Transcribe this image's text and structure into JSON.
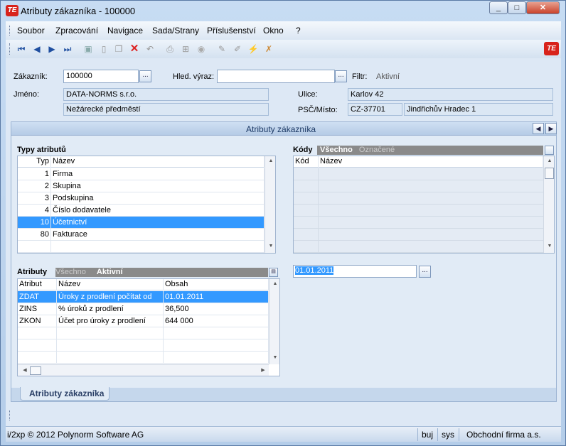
{
  "window": {
    "title": "Atributy zákazníka - 100000",
    "logo": "TE",
    "minimize": "_",
    "maximize": "□",
    "close": "✕"
  },
  "menu": [
    "Soubor",
    "Zpracování",
    "Navigace",
    "Sada/Strany",
    "Příslušenství",
    "Okno",
    "?"
  ],
  "header": {
    "customer_label": "Zákazník:",
    "customer_value": "100000",
    "search_label": "Hled. výraz:",
    "search_value": "",
    "filter_label": "Filtr:",
    "filter_value": "Aktivní",
    "name_label": "Jméno:",
    "name_value": "DATA-NORMS s.r.o.",
    "name2_value": "Nežárecké předměstí",
    "street_label": "Ulice:",
    "street_value": "Karlov 42",
    "zip_label": "PSČ/Místo:",
    "zip_value": "CZ-37701",
    "city_value": "Jindřichův Hradec 1",
    "dots": "..."
  },
  "panel": {
    "title": "Atributy zákazníka"
  },
  "types": {
    "title": "Typy atributů",
    "columns": [
      "Typ",
      "Název"
    ],
    "rows": [
      {
        "typ": "1",
        "nazev": "Firma"
      },
      {
        "typ": "2",
        "nazev": "Skupina"
      },
      {
        "typ": "3",
        "nazev": "Podskupina"
      },
      {
        "typ": "4",
        "nazev": "Číslo dodavatele"
      },
      {
        "typ": "10",
        "nazev": "Účetnictví"
      },
      {
        "typ": "80",
        "nazev": "Fakturace"
      }
    ]
  },
  "codes": {
    "title": "Kódy",
    "filter_all": "Všechno",
    "filter_marked": "Označené",
    "columns": [
      "Kód",
      "Název"
    ],
    "date_value": "01.01.2011"
  },
  "attributes": {
    "title": "Atributy",
    "filter_all": "Všechno",
    "filter_active": "Aktivní",
    "columns": [
      "Atribut",
      "Název",
      "Obsah"
    ],
    "rows": [
      {
        "atribut": "ZDAT",
        "nazev": "Úroky z prodlení počítat od",
        "obsah": "01.01.2011"
      },
      {
        "atribut": "ZINS",
        "nazev": "% úroků z prodlení",
        "obsah": "36,500"
      },
      {
        "atribut": "ZKON",
        "nazev": "Účet pro úroky z prodlení",
        "obsah": "644 000"
      }
    ]
  },
  "bottom_tab": "Atributy zákazníka",
  "status": {
    "copyright": "i/2xp © 2012 Polynorm Software AG",
    "unit": "buj",
    "user": "sys",
    "company": "Obchodní firma a.s."
  }
}
